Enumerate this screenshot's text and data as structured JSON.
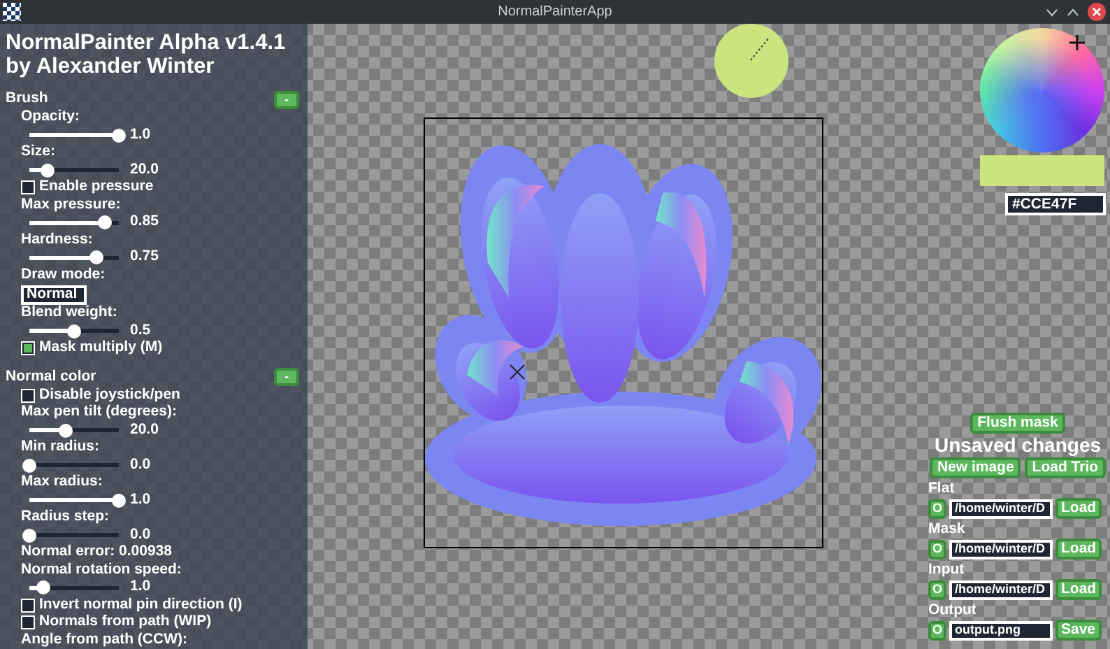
{
  "window": {
    "title": "NormalPainterApp"
  },
  "app_title": "NormalPainter Alpha v1.4.1\nby Alexander Winter",
  "sections": [
    {
      "title": "Brush",
      "toggle": "-",
      "controls": [
        {
          "kind": "label",
          "text": "Opacity:"
        },
        {
          "kind": "slider",
          "level": 1,
          "reading": "1.0"
        },
        {
          "kind": "label",
          "text": "Size:"
        },
        {
          "kind": "slider",
          "level": 0.2,
          "reading": "20.0"
        },
        {
          "kind": "checkbox",
          "text": "Enable pressure",
          "checked": false
        },
        {
          "kind": "label",
          "text": "Max pressure:"
        },
        {
          "kind": "slider",
          "level": 0.85,
          "reading": "0.85"
        },
        {
          "kind": "label",
          "text": "Hardness:"
        },
        {
          "kind": "slider",
          "level": 0.75,
          "reading": "0.75"
        },
        {
          "kind": "label",
          "text": "Draw mode:"
        },
        {
          "kind": "select",
          "text": "Normal"
        },
        {
          "kind": "label",
          "text": "Blend weight:"
        },
        {
          "kind": "slider",
          "level": 0.5,
          "reading": "0.5"
        },
        {
          "kind": "checkbox",
          "text": "Mask multiply (M)",
          "checked": true
        }
      ]
    },
    {
      "title": "Normal color",
      "toggle": "-",
      "controls": [
        {
          "kind": "checkbox",
          "text": "Disable joystick/pen",
          "checked": false
        },
        {
          "kind": "label",
          "text": "Max pen tilt (degrees):"
        },
        {
          "kind": "slider",
          "level": 0.4,
          "reading": "20.0"
        },
        {
          "kind": "label",
          "text": "Min radius:"
        },
        {
          "kind": "slider",
          "level": 0,
          "reading": "0.0"
        },
        {
          "kind": "label",
          "text": "Max radius:"
        },
        {
          "kind": "slider",
          "level": 1,
          "reading": "1.0"
        },
        {
          "kind": "label",
          "text": "Radius step:"
        },
        {
          "kind": "slider",
          "level": 0,
          "reading": "0.0"
        },
        {
          "kind": "label",
          "text": "Normal error: 0.00938"
        },
        {
          "kind": "label",
          "text": "Normal rotation speed:"
        },
        {
          "kind": "slider",
          "level": 0.15,
          "reading": "1.0"
        },
        {
          "kind": "checkbox",
          "text": "Invert normal pin direction (I)",
          "checked": false
        },
        {
          "kind": "checkbox",
          "text": "Normals from path (WIP)",
          "checked": false
        },
        {
          "kind": "label",
          "text": "Angle from path (CCW):"
        }
      ]
    }
  ],
  "color": {
    "hex": "#CCE47F"
  },
  "flush_button": "Flush mask",
  "status": "Unsaved changes",
  "action_buttons": [
    "New image",
    "Load Trio"
  ],
  "files": [
    {
      "label": "Flat",
      "toggle": "O",
      "path": "/home/winter/D",
      "button": "Load"
    },
    {
      "label": "Mask",
      "toggle": "O",
      "path": "/home/winter/D",
      "button": "Load"
    },
    {
      "label": "Input",
      "toggle": "O",
      "path": "/home/winter/D",
      "button": "Load"
    },
    {
      "label": "Output",
      "toggle": "O",
      "path": "output.png",
      "button": "Save"
    }
  ]
}
